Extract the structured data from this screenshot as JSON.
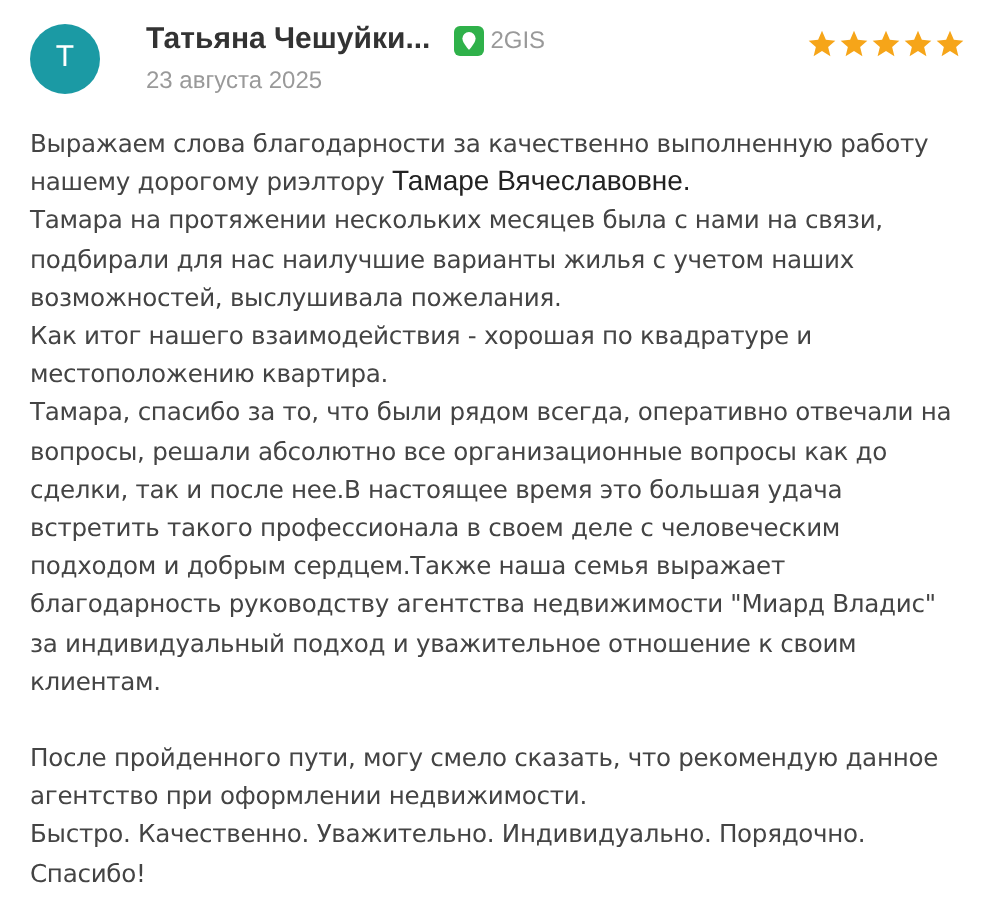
{
  "review": {
    "avatar_letter": "Т",
    "author": "Татьяна Чешуйки...",
    "source": "2GIS",
    "date": "23 августа 2025",
    "stars": 5,
    "sections": [
      [
        {
          "text": "Выражаем слова благодарности за качественно выполненную работу нашему дорогому риэлтору ",
          "mention": "Тамаре Вячеславовне."
        },
        {
          "text": "Тамара на протяжении нескольких месяцев была с нами на связи, подбирали для нас наилучшие варианты жилья с учетом наших возможностей, выслушивала пожелания."
        },
        {
          "text": "Как итог нашего взаимодействия - хорошая по квадратуре и местоположению квартира."
        },
        {
          "text": "Тамара, спасибо за то, что были рядом всегда, оперативно отвечали на вопросы, решали абсолютно все организационные вопросы как до сделки, так и после нее.В настоящее время это большая удача встретить такого профессионала в своем деле с человеческим подходом и добрым сердцем.Также наша семья выражает благодарность руководству агентства недвижимости \"Миард Владис\" за индивидуальный подход и уважительное отношение к своим клиентам."
        }
      ],
      [
        {
          "text": "После пройденного пути, могу смело сказать, что рекомендую данное агентство при оформлении недвижимости."
        },
        {
          "text": "Быстро. Качественно. Уважительно. Индивидуально. Порядочно."
        },
        {
          "text": "Спасибо!"
        }
      ]
    ]
  }
}
